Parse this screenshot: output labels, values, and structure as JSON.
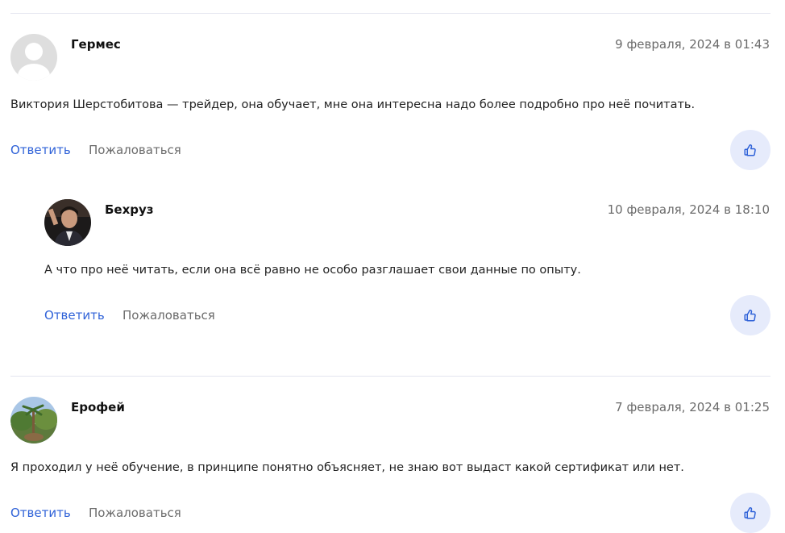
{
  "comments": [
    {
      "author": "Гермес",
      "date": "9 февраля, 2024 в 01:43",
      "text": "Виктория Шерстобитова — трейдер, она обучает, мне она интересна надо более подробно про неё почитать.",
      "reply_label": "Ответить",
      "report_label": "Пожаловаться",
      "avatar": "default-user-avatar"
    },
    {
      "author": "Бехруз",
      "date": "10 февраля, 2024 в 18:10",
      "text": "А что про неё читать, если она всё равно не особо разглашает свои данные по опыту.",
      "reply_label": "Ответить",
      "report_label": "Пожаловаться",
      "avatar": "photo-person-avatar",
      "is_reply": true
    },
    {
      "author": "Ерофей",
      "date": "7 февраля, 2024 в 01:25",
      "text": "Я проходил у неё обучение, в принципе понятно объясняет, не знаю вот выдаст какой сертификат или нет.",
      "reply_label": "Ответить",
      "report_label": "Пожаловаться",
      "avatar": "photo-palm-trees-avatar"
    }
  ],
  "icons": {
    "like": "thumbs-up-icon"
  },
  "colors": {
    "accent": "#2f62d8",
    "like_bg": "#e6ebfb",
    "muted": "#6b6b6b",
    "divider": "#e3e5ef"
  }
}
